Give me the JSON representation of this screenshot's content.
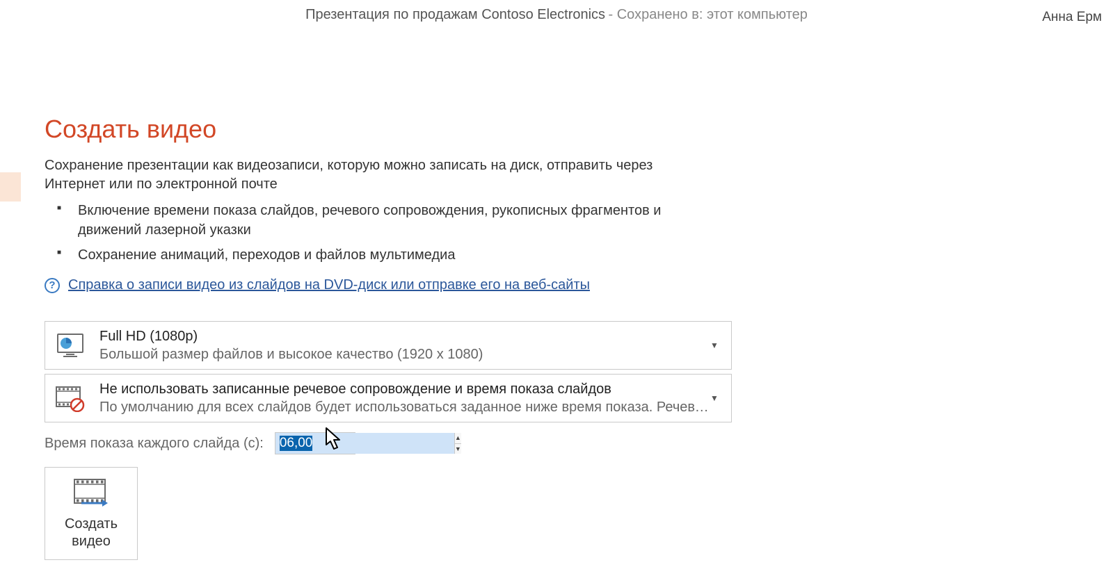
{
  "titlebar": {
    "presentation_title": "Презентация по продажам Contoso Electronics",
    "saved_prefix": " -  Сохранено в: этот компьютер",
    "username": "Анна Ерм"
  },
  "page": {
    "title": "Создать видео",
    "subtitle": "Сохранение презентации как видеозаписи, которую можно записать на диск, отправить через Интернет или по электронной почте",
    "bullets": [
      "Включение времени показа слайдов, речевого сопровождения, рукописных фрагментов и движений лазерной указки",
      "Сохранение анимаций, переходов и файлов мультимедиа"
    ],
    "help_link": "Справка о записи видео из слайдов на DVD-диск или отправке его на веб-сайты"
  },
  "quality": {
    "title": "Full HD (1080p)",
    "desc": "Большой размер файлов и высокое качество (1920 x 1080)"
  },
  "timings": {
    "title": "Не использовать записанные речевое сопровождение и время показа слайдов",
    "desc": "По умолчанию для всех слайдов будет использоваться заданное ниже время показа. Речевое со…"
  },
  "seconds": {
    "label": "Время показа каждого слайда (с):",
    "value": "06,00"
  },
  "create_button": {
    "label": "Создать видео"
  }
}
